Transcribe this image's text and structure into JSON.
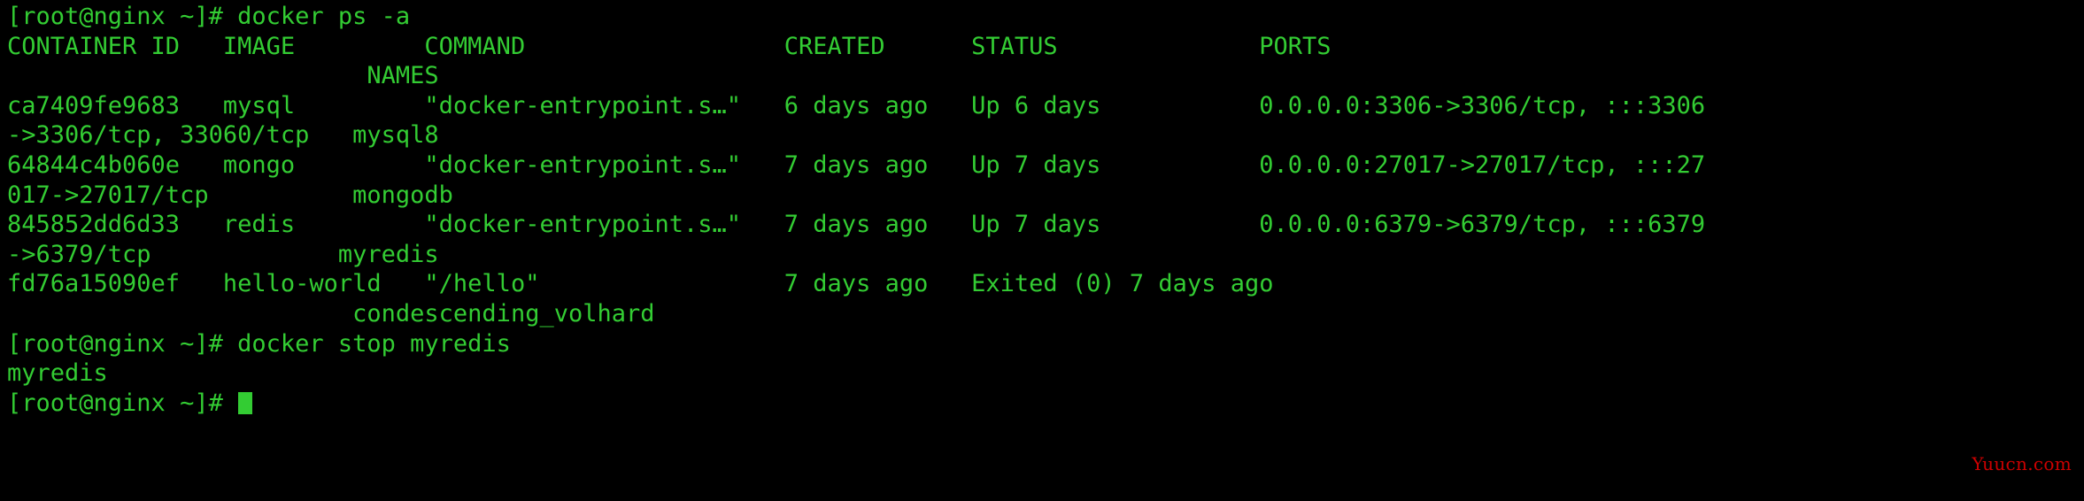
{
  "terminal": {
    "prompt": "[root@nginx ~]#",
    "foreground_color": "#33cc33",
    "background_color": "#000000",
    "lines": [
      "[root@nginx ~]# docker ps -a",
      "CONTAINER ID   IMAGE         COMMAND                  CREATED      STATUS              PORTS",
      "                         NAMES",
      "ca7409fe9683   mysql         \"docker-entrypoint.s…\"   6 days ago   Up 6 days           0.0.0.0:3306->3306/tcp, :::3306",
      "->3306/tcp, 33060/tcp   mysql8",
      "64844c4b060e   mongo         \"docker-entrypoint.s…\"   7 days ago   Up 7 days           0.0.0.0:27017->27017/tcp, :::27",
      "017->27017/tcp          mongodb",
      "845852dd6d33   redis         \"docker-entrypoint.s…\"   7 days ago   Up 7 days           0.0.0.0:6379->6379/tcp, :::6379",
      "->6379/tcp             myredis",
      "fd76a15090ef   hello-world   \"/hello\"                 7 days ago   Exited (0) 7 days ago",
      "                        condescending_volhard",
      "[root@nginx ~]# docker stop myredis",
      "myredis",
      "[root@nginx ~]# "
    ],
    "commands": [
      "docker ps -a",
      "docker stop myredis"
    ],
    "table": {
      "headers": [
        "CONTAINER ID",
        "IMAGE",
        "COMMAND",
        "CREATED",
        "STATUS",
        "PORTS",
        "NAMES"
      ],
      "rows": [
        {
          "container_id": "ca7409fe9683",
          "image": "mysql",
          "command": "\"docker-entrypoint.s…\"",
          "created": "6 days ago",
          "status": "Up 6 days",
          "ports": "0.0.0.0:3306->3306/tcp, :::3306->3306/tcp, 33060/tcp",
          "names": "mysql8"
        },
        {
          "container_id": "64844c4b060e",
          "image": "mongo",
          "command": "\"docker-entrypoint.s…\"",
          "created": "7 days ago",
          "status": "Up 7 days",
          "ports": "0.0.0.0:27017->27017/tcp, :::27017->27017/tcp",
          "names": "mongodb"
        },
        {
          "container_id": "845852dd6d33",
          "image": "redis",
          "command": "\"docker-entrypoint.s…\"",
          "created": "7 days ago",
          "status": "Up 7 days",
          "ports": "0.0.0.0:6379->6379/tcp, :::6379->6379/tcp",
          "names": "myredis"
        },
        {
          "container_id": "fd76a15090ef",
          "image": "hello-world",
          "command": "\"/hello\"",
          "created": "7 days ago",
          "status": "Exited (0) 7 days ago",
          "ports": "",
          "names": "condescending_volhard"
        }
      ]
    },
    "stop_output": "myredis"
  },
  "watermark": {
    "text": "Yuucn.com",
    "color": "#cc0000"
  }
}
